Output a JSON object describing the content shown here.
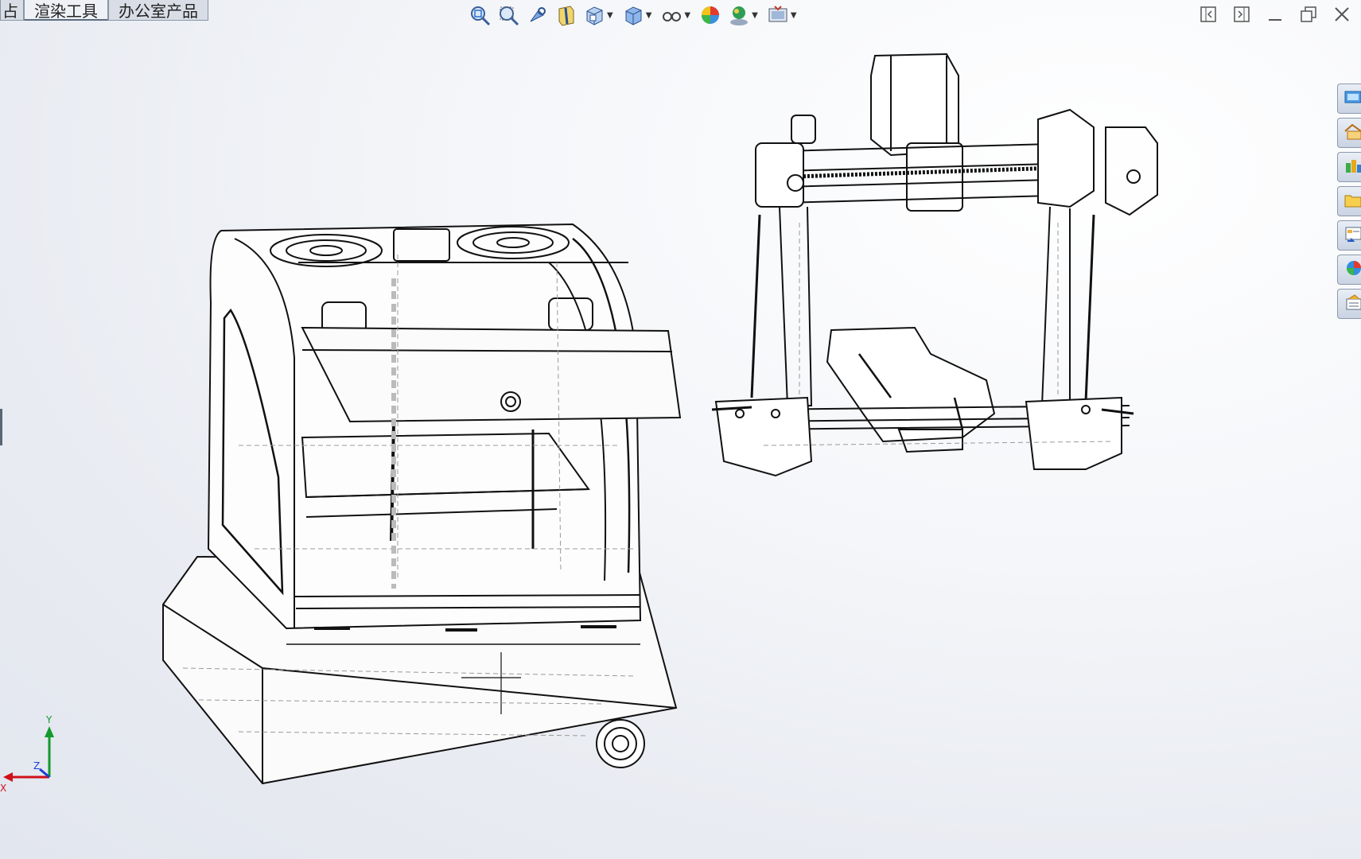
{
  "tabs": [
    {
      "label": "占",
      "active": false
    },
    {
      "label": "渲染工具",
      "active": true
    },
    {
      "label": "办公室产品",
      "active": false
    }
  ],
  "toolbar": {
    "icons": [
      {
        "name": "zoom-to-fit-icon",
        "dropdown": false
      },
      {
        "name": "zoom-to-area-icon",
        "dropdown": false
      },
      {
        "name": "previous-view-icon",
        "dropdown": false
      },
      {
        "name": "section-view-icon",
        "dropdown": false
      },
      {
        "name": "view-orientation-icon",
        "dropdown": true
      },
      {
        "name": "display-style-icon",
        "dropdown": true
      },
      {
        "name": "hide-show-items-icon",
        "dropdown": true
      },
      {
        "name": "edit-appearance-icon",
        "dropdown": false
      },
      {
        "name": "apply-scene-icon",
        "dropdown": true
      },
      {
        "name": "view-settings-icon",
        "dropdown": true
      }
    ]
  },
  "window_controls": [
    "tile-left-icon",
    "tile-right-icon",
    "minimize-icon",
    "restore-icon",
    "close-icon"
  ],
  "task_pane": [
    "solidworks-resources-icon",
    "home-icon",
    "design-library-icon",
    "file-explorer-icon",
    "view-palette-icon",
    "appearances-scenes-icon",
    "custom-properties-icon"
  ],
  "triad": {
    "x_label": "X",
    "y_label": "Y",
    "z_label": "Z"
  },
  "colors": {
    "x_axis": "#d0101a",
    "y_axis": "#139a2b",
    "z_axis": "#1a3fd6",
    "model_line": "#111111"
  }
}
